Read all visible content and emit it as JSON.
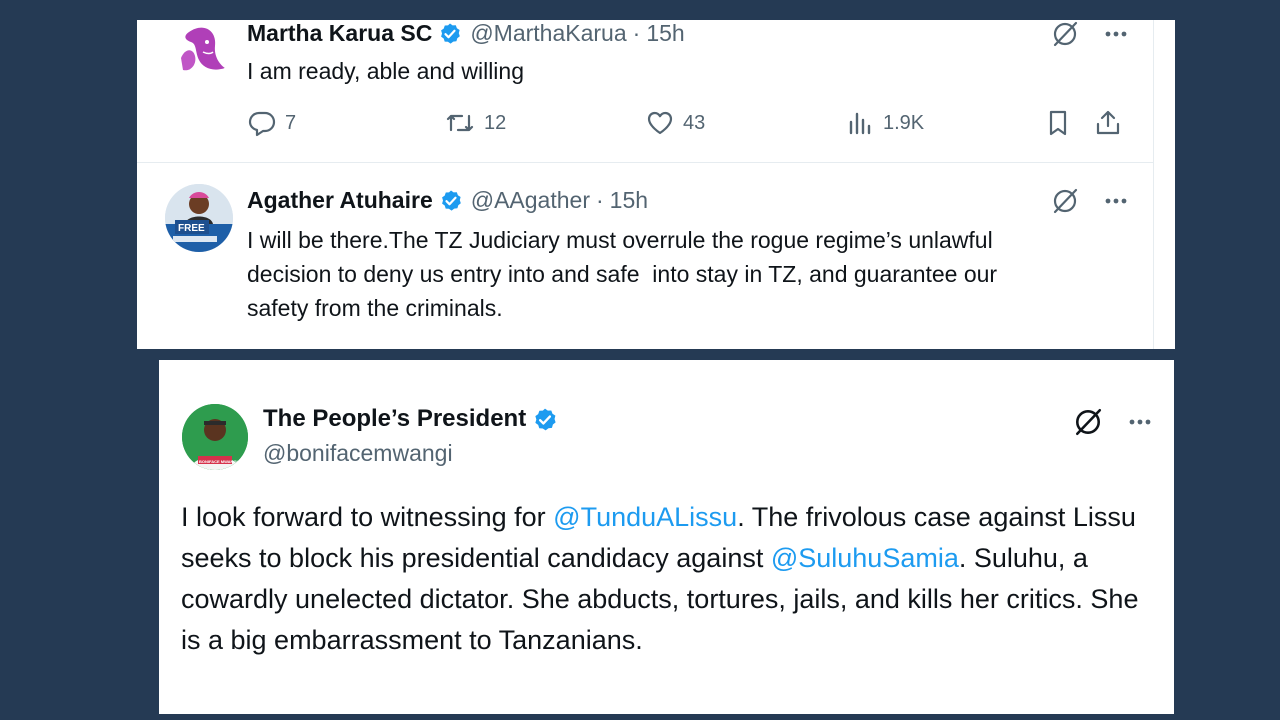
{
  "tweets": [
    {
      "name": "Martha Karua SC",
      "handle": "@MarthaKarua",
      "time": "15h",
      "text": "I am ready, able and willing",
      "replies": "7",
      "retweets": "12",
      "likes": "43",
      "views": "1.9K"
    },
    {
      "name": "Agather Atuhaire",
      "handle": "@AAgather",
      "time": "15h",
      "text": "I will be there.The TZ Judiciary must overrule the rogue regime’s unlawful\ndecision to deny us entry into and safe  into stay in TZ, and guarantee our\nsafety from the criminals.",
      "avatar_label": "FREE"
    }
  ],
  "featured": {
    "name": "The People’s President",
    "handle": "@bonifacemwangi",
    "text_parts": [
      "I look forward to witnessing for ",
      "@TunduALissu",
      ". The frivolous case against Lissu seeks to block his presidential candidacy against ",
      "@SuluhuSamia",
      ". Suluhu, a cowardly unelected dictator. She abducts, tortures, jails, and kills her critics. She is a big embarrassment to Tanzanians."
    ],
    "avatar_label": "BONIFACE MWANGI"
  },
  "separator": "·",
  "colors": {
    "background": "#253a54",
    "card": "#ffffff",
    "link": "#1d9bf0",
    "verified": "#1d9bf0",
    "muted": "#536471",
    "text": "#0f1419"
  },
  "icons": [
    "verified-badge-icon",
    "grok-icon",
    "more-icon",
    "reply-icon",
    "retweet-icon",
    "like-icon",
    "views-icon",
    "bookmark-icon",
    "share-icon"
  ]
}
